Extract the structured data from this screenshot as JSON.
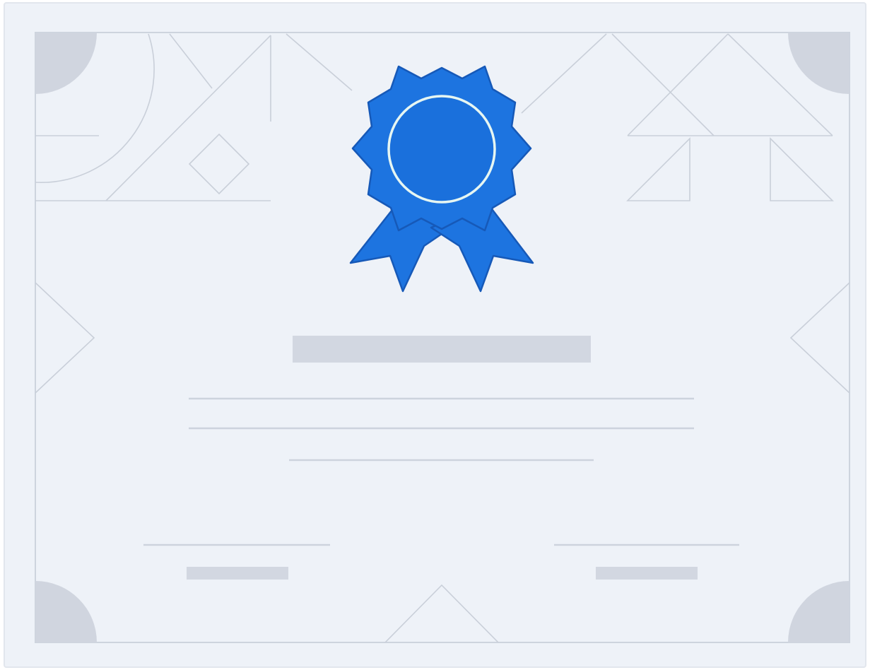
{
  "certificate": {
    "badge_icon": "award-ribbon-icon",
    "colors": {
      "paper": "#eef2f8",
      "border": "#cdd4de",
      "pattern_line": "#c9cfd9",
      "placeholder": "#d2d7e1",
      "corner": "#d0d5df",
      "ribbon": "#1d74e0",
      "ribbon_outline": "#1659b8",
      "medallion_ring": "#e6f6f2"
    }
  }
}
